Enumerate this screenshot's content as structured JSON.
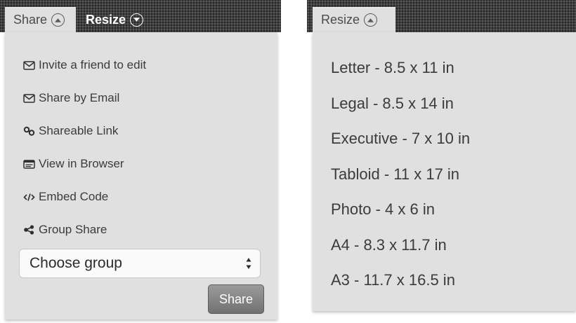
{
  "left": {
    "tab_active": {
      "label": "Share",
      "icon": "chevron-up-icon"
    },
    "tab_inactive": {
      "label": "Resize",
      "icon": "chevron-down-icon"
    },
    "menu_items": [
      {
        "icon": "envelope-icon",
        "label": "Invite a friend to edit"
      },
      {
        "icon": "envelope-icon",
        "label": "Share by Email"
      },
      {
        "icon": "link-icon",
        "label": "Shareable Link"
      },
      {
        "icon": "browser-window-icon",
        "label": "View in Browser"
      },
      {
        "icon": "code-icon",
        "label": "Embed Code"
      },
      {
        "icon": "share-nodes-icon",
        "label": "Group Share"
      }
    ],
    "group_select": {
      "value": "Choose group",
      "icon": "select-arrows-icon"
    },
    "share_button": "Share"
  },
  "right": {
    "tab_active": {
      "label": "Resize",
      "icon": "chevron-up-icon"
    },
    "sizes": [
      "Letter - 8.5 x 11 in",
      "Legal - 8.5 x 14 in",
      "Executive - 7 x 10 in",
      "Tabloid - 11 x 17 in",
      "Photo - 4 x 6 in",
      "A4 - 8.3 x 11.7 in",
      "A3 - 11.7 x 16.5 in"
    ]
  }
}
